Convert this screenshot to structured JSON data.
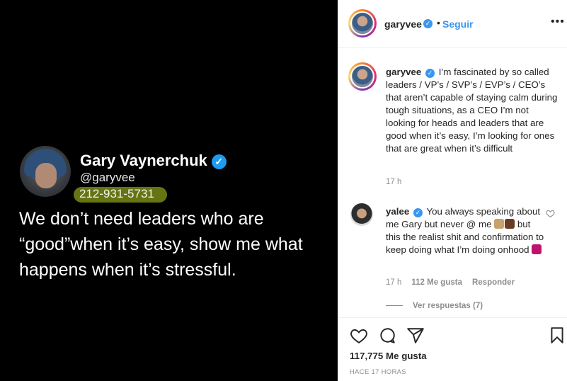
{
  "post_image": {
    "name": "Gary Vaynerchuk",
    "handle": "@garyvee",
    "phone": "212-931-5731",
    "text": "We don’t need leaders who are “good”when it’s easy, show me what happens when it’s stressful."
  },
  "header": {
    "username": "garyvee",
    "separator": "•",
    "follow_label": "Seguir",
    "more_label": "•••"
  },
  "caption": {
    "username": "garyvee",
    "text": "I’m fascinated by so called leaders / VP’s / SVP’s / EVP’s / CEO’s that aren’t capable of staying calm during tough situations, as a CEO I’m not looking for heads and leaders that are good when it’s easy, I’m looking for ones that are great when it’s difficult",
    "time": "17 h"
  },
  "comment": {
    "username": "yalee",
    "text_part1": "You always speaking about me Gary but never @ me",
    "text_part2": "but this the realist shit and confirmation to keep doing what I’m doing onhood",
    "time": "17 h",
    "likes": "112 Me gusta",
    "reply_label": "Responder",
    "view_replies": "Ver respuestas (7)"
  },
  "footer": {
    "likes": "117,775 Me gusta",
    "posted": "HACE 17 HORAS"
  },
  "icons": {
    "verified": "verified-badge-icon",
    "like": "heart-icon",
    "comment": "comment-icon",
    "share": "share-icon",
    "save": "bookmark-icon"
  },
  "colors": {
    "link_blue": "#3897f0",
    "twitter_blue": "#1d9bf0",
    "muted": "#8e8e8e",
    "text": "#262626"
  }
}
